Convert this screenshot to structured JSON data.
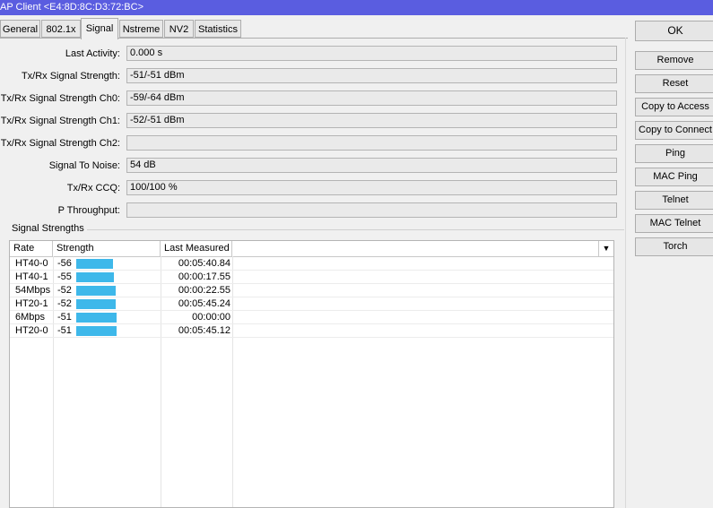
{
  "window": {
    "title": "AP Client <E4:8D:8C:D3:72:BC>"
  },
  "tabs": [
    "General",
    "802.1x",
    "Signal",
    "Nstreme",
    "NV2",
    "Statistics"
  ],
  "active_tab": "Signal",
  "fields": [
    {
      "label": "Last Activity:",
      "value": "0.000 s"
    },
    {
      "label": "Tx/Rx Signal Strength:",
      "value": "-51/-51 dBm"
    },
    {
      "label": "Tx/Rx Signal Strength Ch0:",
      "value": "-59/-64 dBm"
    },
    {
      "label": "Tx/Rx Signal Strength Ch1:",
      "value": "-52/-51 dBm"
    },
    {
      "label": "Tx/Rx Signal Strength Ch2:",
      "value": ""
    },
    {
      "label": "Signal To Noise:",
      "value": "54 dB"
    },
    {
      "label": "Tx/Rx CCQ:",
      "value": "100/100 %"
    },
    {
      "label": "P Throughput:",
      "value": ""
    }
  ],
  "signal_group": {
    "title": "Signal Strengths",
    "columns": [
      "Rate",
      "Strength",
      "Last Measured"
    ],
    "sort_icon": "triangle-down-icon",
    "bar_color": "#3eb8ea",
    "rows": [
      {
        "rate": "HT40-0",
        "strength": "-56",
        "last_measured": "00:05:40.84"
      },
      {
        "rate": "HT40-1",
        "strength": "-55",
        "last_measured": "00:00:17.55"
      },
      {
        "rate": "54Mbps",
        "strength": "-52",
        "last_measured": "00:00:22.55"
      },
      {
        "rate": "HT20-1",
        "strength": "-52",
        "last_measured": "00:05:45.24"
      },
      {
        "rate": "6Mbps",
        "strength": "-51",
        "last_measured": "00:00:00"
      },
      {
        "rate": "HT20-0",
        "strength": "-51",
        "last_measured": "00:05:45.12"
      }
    ]
  },
  "buttons": {
    "ok": "OK",
    "remove": "Remove",
    "reset": "Reset",
    "copy_access": "Copy to Access",
    "copy_connect": "Copy to Connect",
    "ping": "Ping",
    "mac_ping": "MAC Ping",
    "telnet": "Telnet",
    "mac_telnet": "MAC Telnet",
    "torch": "Torch"
  },
  "colors": {
    "titlebar": "#5a5de0"
  }
}
